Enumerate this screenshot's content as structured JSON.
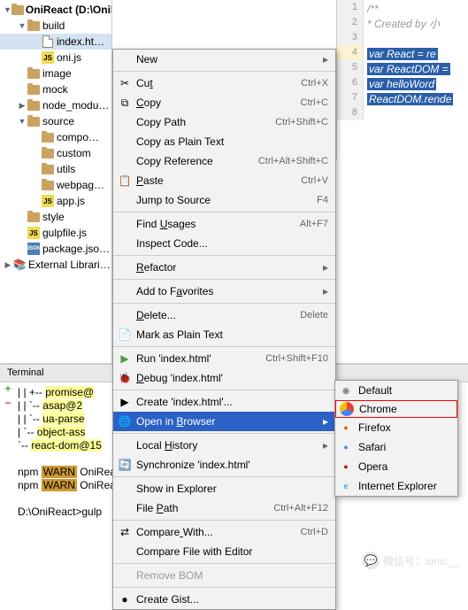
{
  "project": {
    "name": "OniReact",
    "path": "(D:\\OniReact)"
  },
  "tree": [
    {
      "label": "OniReact",
      "icon": "folder",
      "indent": 0,
      "arrow": "▼",
      "path_suffix": " (D:\\OniReact)"
    },
    {
      "label": "build",
      "icon": "folder",
      "indent": 1,
      "arrow": "▼"
    },
    {
      "label": "index.ht…",
      "icon": "html",
      "indent": 2,
      "selected": true
    },
    {
      "label": "oni.js",
      "icon": "js",
      "indent": 2
    },
    {
      "label": "image",
      "icon": "folder",
      "indent": 1
    },
    {
      "label": "mock",
      "icon": "folder",
      "indent": 1
    },
    {
      "label": "node_modu…",
      "icon": "folder",
      "indent": 1,
      "arrow": "▶"
    },
    {
      "label": "source",
      "icon": "folder",
      "indent": 1,
      "arrow": "▼"
    },
    {
      "label": "compo…",
      "icon": "folder",
      "indent": 2
    },
    {
      "label": "custom",
      "icon": "folder",
      "indent": 2
    },
    {
      "label": "utils",
      "icon": "folder",
      "indent": 2
    },
    {
      "label": "webpag…",
      "icon": "folder",
      "indent": 2
    },
    {
      "label": "app.js",
      "icon": "js",
      "indent": 2
    },
    {
      "label": "style",
      "icon": "folder",
      "indent": 1
    },
    {
      "label": "gulpfile.js",
      "icon": "js",
      "indent": 1
    },
    {
      "label": "package.jso…",
      "icon": "json",
      "indent": 1
    },
    {
      "label": "External Librari…",
      "icon": "lib",
      "indent": 0,
      "arrow": "▶"
    }
  ],
  "editor": {
    "lines": [
      {
        "n": 1,
        "text": "/**",
        "cls": "cmt"
      },
      {
        "n": 2,
        "text": " * Created by 小",
        "cls": "cmt"
      },
      {
        "n": 3,
        "text": "",
        "cls": ""
      },
      {
        "n": 4,
        "text": "var React = re",
        "cls": "hl",
        "cur": true
      },
      {
        "n": 5,
        "text": "var ReactDOM =",
        "cls": "hl"
      },
      {
        "n": 6,
        "text": "var helloWord ",
        "cls": "hl"
      },
      {
        "n": 7,
        "text": "ReactDOM.rende",
        "cls": "hl"
      },
      {
        "n": 8,
        "text": "",
        "cls": ""
      }
    ]
  },
  "context_menu": [
    {
      "label": "New",
      "sub": "▸"
    },
    {
      "sep": true
    },
    {
      "label": "Cut",
      "u": 2,
      "sc": "Ctrl+X",
      "icon": "cut"
    },
    {
      "label": "Copy",
      "u": 0,
      "sc": "Ctrl+C",
      "icon": "copy"
    },
    {
      "label": "Copy Path",
      "sc": "Ctrl+Shift+C"
    },
    {
      "label": "Copy as Plain Text"
    },
    {
      "label": "Copy Reference",
      "sc": "Ctrl+Alt+Shift+C"
    },
    {
      "label": "Paste",
      "u": 0,
      "sc": "Ctrl+V",
      "icon": "paste"
    },
    {
      "label": "Jump to Source",
      "sc": "F4"
    },
    {
      "sep": true
    },
    {
      "label": "Find Usages",
      "u": 5,
      "sc": "Alt+F7"
    },
    {
      "label": "Inspect Code..."
    },
    {
      "sep": true
    },
    {
      "label": "Refactor",
      "u": 0,
      "sub": "▸"
    },
    {
      "sep": true
    },
    {
      "label": "Add to Favorites",
      "u": 8,
      "sub": "▸"
    },
    {
      "sep": true
    },
    {
      "label": "Delete...",
      "u": 0,
      "sc": "Delete"
    },
    {
      "label": "Mark as Plain Text",
      "icon": "mark"
    },
    {
      "sep": true
    },
    {
      "label": "Run 'index.html'",
      "sc": "Ctrl+Shift+F10",
      "icon": "run"
    },
    {
      "label": "Debug 'index.html'",
      "u": 0,
      "icon": "debug"
    },
    {
      "sep": true
    },
    {
      "label": "Create 'index.html'...",
      "icon": "create"
    },
    {
      "label": "Open in Browser",
      "u": 8,
      "sub": "▸",
      "icon": "browser",
      "active": true
    },
    {
      "sep": true
    },
    {
      "label": "Local History",
      "u": 6,
      "sub": "▸"
    },
    {
      "label": "Synchronize 'index.html'",
      "icon": "sync"
    },
    {
      "sep": true
    },
    {
      "label": "Show in Explorer"
    },
    {
      "label": "File Path",
      "u": 5,
      "sc": "Ctrl+Alt+F12"
    },
    {
      "sep": true
    },
    {
      "label": "Compare With...",
      "u": 7,
      "sc": "Ctrl+D",
      "icon": "compare"
    },
    {
      "label": "Compare File with Editor"
    },
    {
      "sep": true
    },
    {
      "label": "Remove BOM",
      "disabled": true
    },
    {
      "sep": true
    },
    {
      "label": "Create Gist...",
      "icon": "gist"
    }
  ],
  "browser_submenu": [
    {
      "label": "Default",
      "color": "#888",
      "glyph": "◉"
    },
    {
      "label": "Chrome",
      "selected": true,
      "color": "",
      "glyph": ""
    },
    {
      "label": "Firefox",
      "color": "#e66000",
      "glyph": "●"
    },
    {
      "label": "Safari",
      "color": "#4a90d9",
      "glyph": "●"
    },
    {
      "label": "Opera",
      "color": "#cc0f16",
      "glyph": "●"
    },
    {
      "label": "Internet Explorer",
      "color": "#1ebbee",
      "glyph": "e"
    }
  ],
  "terminal": {
    "title": "Terminal",
    "lines": [
      "| | +-- promise@",
      "| | `-- asap@2",
      "| | `-- ua-parse",
      "| `-- object-ass",
      "`-- react-dom@15",
      "",
      "npm WARN OniReac",
      "npm WARN OniReac",
      "",
      "D:\\OniReact>gulp"
    ]
  },
  "watermark": "微信号：ionic__"
}
